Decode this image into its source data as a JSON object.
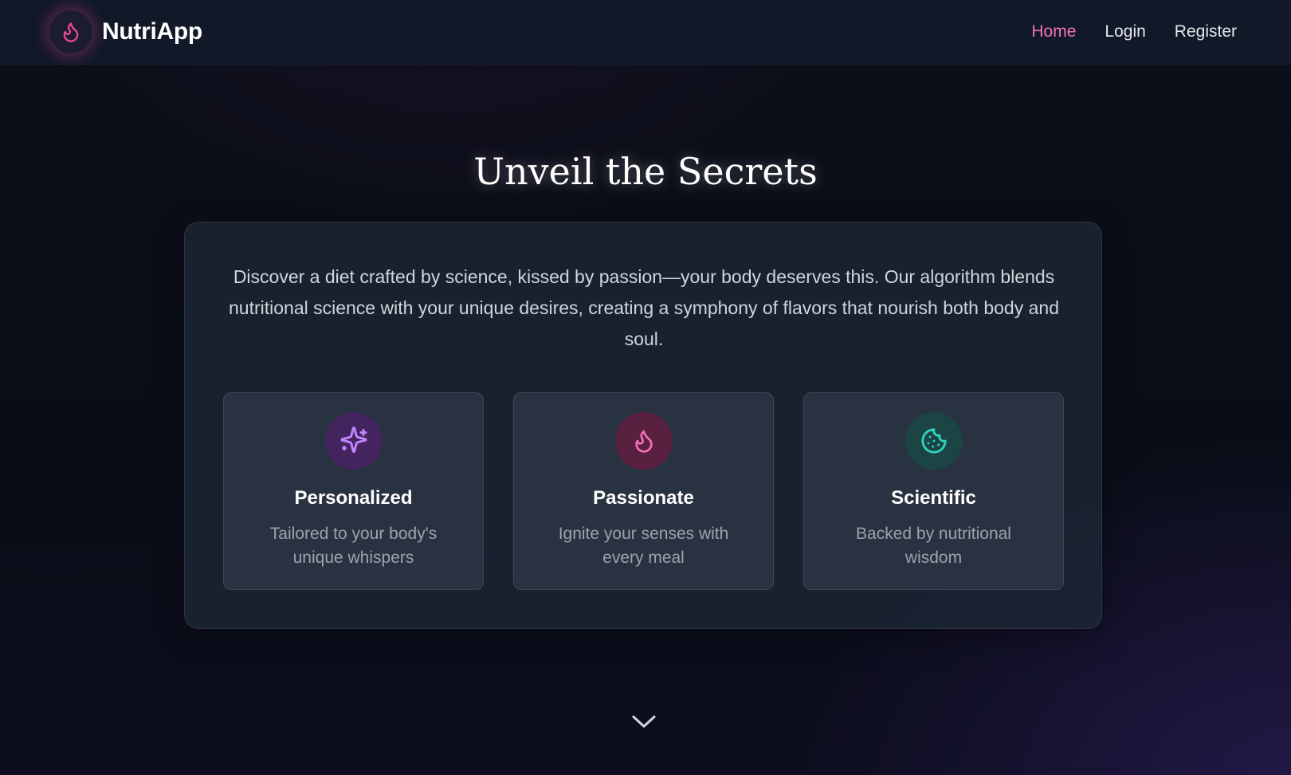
{
  "nav": {
    "brand": "NutriApp",
    "logo_icon": "flame-icon",
    "links": [
      {
        "label": "Home",
        "active": true
      },
      {
        "label": "Login",
        "active": false
      },
      {
        "label": "Register",
        "active": false
      }
    ]
  },
  "hero": {
    "title": "Unveil the Secrets",
    "description": "Discover a diet crafted by science, kissed by passion—your body deserves this. Our algorithm blends nutritional science with your unique desires, creating a symphony of flavors that nourish both body and soul."
  },
  "features": [
    {
      "icon": "sparkles-icon",
      "title": "Personalized",
      "text": "Tailored to your body's unique whispers",
      "color": "#c084fc"
    },
    {
      "icon": "flame-icon",
      "title": "Passionate",
      "text": "Ignite your senses with every meal",
      "color": "#f472b6"
    },
    {
      "icon": "cookie-icon",
      "title": "Scientific",
      "text": "Backed by nutritional wisdom",
      "color": "#2dd4bf"
    }
  ],
  "scroll_icon": "chevron-down-icon",
  "colors": {
    "accent": "#f472b6",
    "background": "#0a0d17",
    "navbar": "#111827",
    "panel": "#1f2937"
  }
}
